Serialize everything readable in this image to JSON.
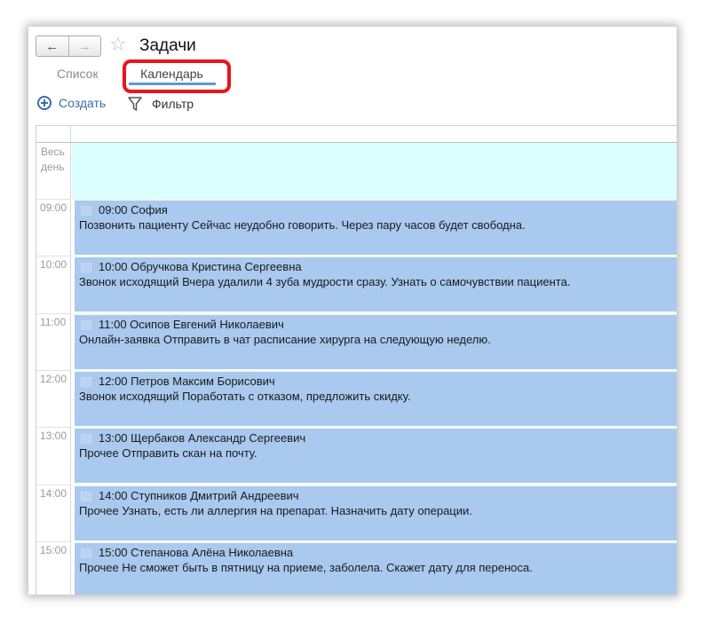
{
  "window": {
    "title": "Задачи",
    "nav_back": "🡐",
    "nav_forward": "🡒",
    "favorite_icon": "star-icon"
  },
  "tabs": [
    {
      "label": "Список",
      "active": false
    },
    {
      "label": "Календарь",
      "active": true
    }
  ],
  "toolbar": {
    "create_label": "Создать",
    "filter_label": "Фильтр"
  },
  "calendar": {
    "all_day_label": "Весь день",
    "hours": [
      "09:00",
      "10:00",
      "11:00",
      "12:00",
      "13:00",
      "14:00",
      "15:00"
    ],
    "events": [
      {
        "header": "09:00 София",
        "body": "Позвонить пациенту Сейчас неудобно говорить. Через пару часов будет свободна."
      },
      {
        "header": "10:00 Обручкова Кристина Сергеевна",
        "body": "Звонок исходящий Вчера удалили 4 зуба мудрости сразу. Узнать о самочувствии пациента."
      },
      {
        "header": "11:00 Осипов Евгений Николаевич",
        "body": "Онлайн-заявка Отправить в чат расписание хирурга на следующую неделю."
      },
      {
        "header": "12:00 Петров Максим Борисович",
        "body": "Звонок исходящий Поработать с отказом, предложить скидку."
      },
      {
        "header": "13:00 Щербаков Александр Сергеевич",
        "body": "Прочее Отправить скан на почту."
      },
      {
        "header": "14:00 Ступников Дмитрий Андреевич",
        "body": "Прочее Узнать, есть ли аллергия на препарат. Назначить дату операции."
      },
      {
        "header": "15:00 Степанова Алёна Николаевна",
        "body": "Прочее Не сможет быть в пятницу на приеме, заболела. Скажет дату для переноса."
      }
    ]
  },
  "colors": {
    "event_bg": "#a9c9ee",
    "all_day_bg": "#dcffff",
    "highlight": "#e8161c",
    "accent": "#3a6ea8"
  }
}
